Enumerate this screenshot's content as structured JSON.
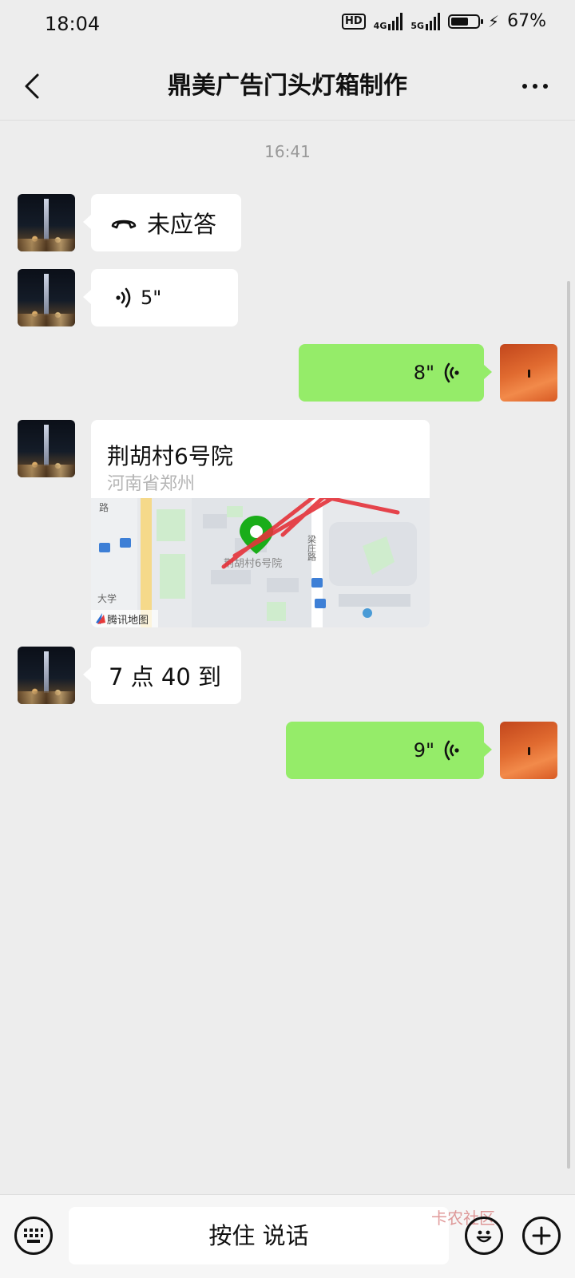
{
  "status_bar": {
    "time": "18:04",
    "hd_label": "HD",
    "net1": "4G",
    "net2": "5G",
    "battery_percent_text": "67%",
    "battery_level": 0.67
  },
  "header": {
    "title": "鼎美广告门头灯箱制作"
  },
  "chat": {
    "timestamp": "16:41",
    "missed_call_label": "未应答",
    "voice_in_duration": "5\"",
    "voice_out_1_duration": "8\"",
    "location": {
      "title": "荆胡村6号院",
      "address": "河南省郑州",
      "map_labels": {
        "road_left": "路",
        "road_mid": "梁庄路",
        "pin_label": "荆胡村6号院",
        "road_bottom": "大学",
        "provider": "腾讯地图"
      }
    },
    "text_message": "7 点 40 到",
    "voice_out_2_duration": "9\""
  },
  "input_bar": {
    "hold_to_talk_label": "按住 说话",
    "watermark": "卡农社区"
  },
  "colors": {
    "background": "#ededed",
    "outgoing_bubble": "#95ec69",
    "incoming_bubble": "#ffffff",
    "map_pin": "#1aad19"
  }
}
